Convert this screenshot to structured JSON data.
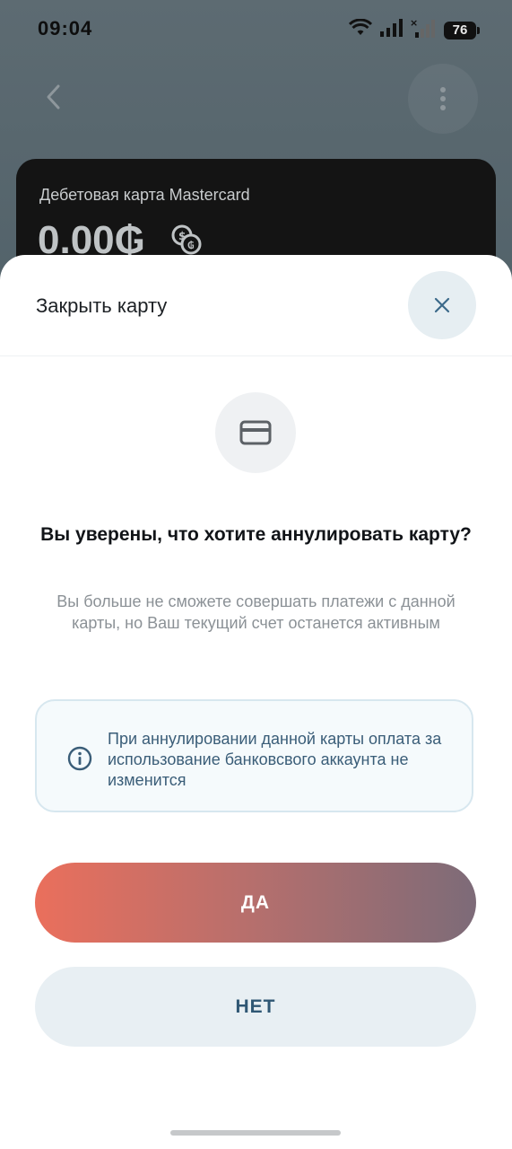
{
  "status_bar": {
    "time": "09:04",
    "battery": "76",
    "icons": [
      "wifi-icon",
      "signal-icon",
      "signal-off-icon",
      "battery-icon"
    ]
  },
  "background_screen": {
    "card": {
      "title": "Дебетовая карта Mastercard",
      "balance": "0.00₲"
    },
    "icons": [
      "chevron-left-icon",
      "more-vertical-icon",
      "currency-exchange-icon"
    ]
  },
  "sheet": {
    "title": "Закрыть карту",
    "question": "Вы уверены, что хотите аннулировать карту?",
    "description": "Вы больше не сможете совершать платежи с данной карты, но Ваш текущий счет останется активным",
    "info": "При аннулировании данной карты оплата за использование банковсвого аккаунта  не изменится",
    "yes_label": "ДА",
    "no_label": "НЕТ"
  },
  "colors": {
    "yes_gradient_start": "#ea6f5c",
    "yes_gradient_end": "#7d6b78",
    "no_button_bg": "#e8eff3",
    "no_button_text": "#2f5774",
    "info_text": "#3a5d78"
  }
}
